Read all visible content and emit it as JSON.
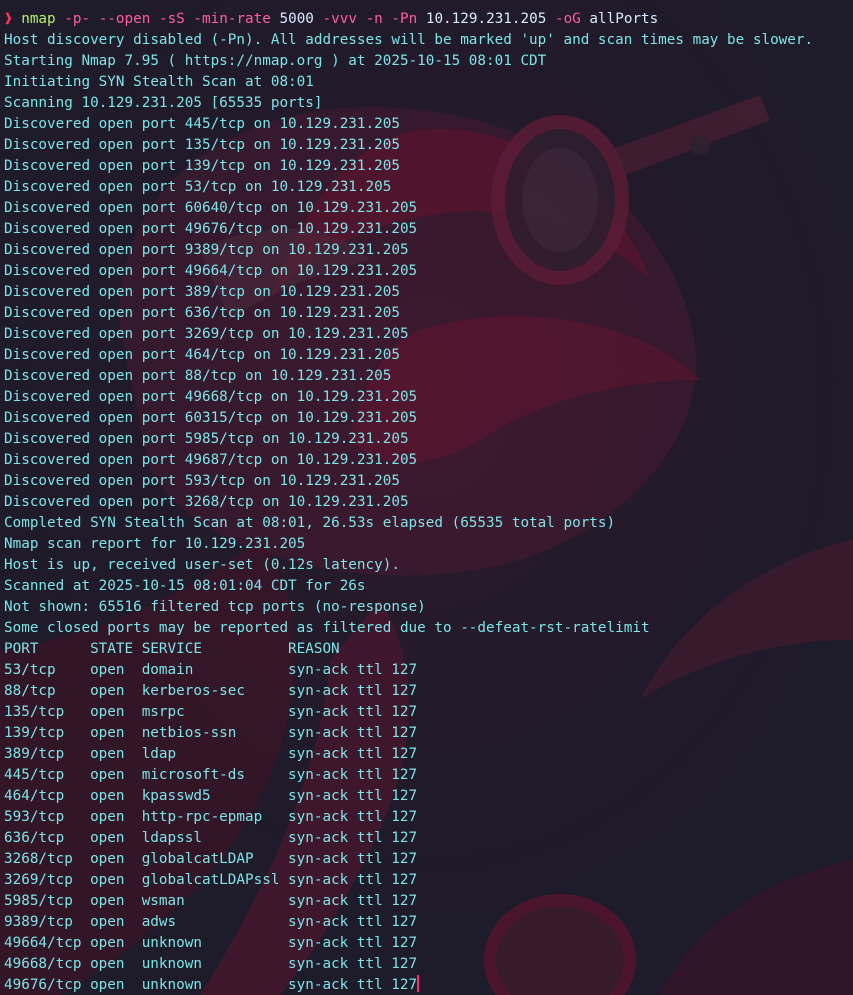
{
  "prompt": {
    "symbol": "❱",
    "command": "nmap",
    "tokens": [
      {
        "text": "-p-",
        "kind": "flag"
      },
      {
        "text": "--open",
        "kind": "flag"
      },
      {
        "text": "-sS",
        "kind": "flag"
      },
      {
        "text": "-min-rate",
        "kind": "flag"
      },
      {
        "text": "5000",
        "kind": "arg"
      },
      {
        "text": "-vvv",
        "kind": "flag"
      },
      {
        "text": "-n",
        "kind": "flag"
      },
      {
        "text": "-Pn",
        "kind": "flag"
      },
      {
        "text": "10.129.231.205",
        "kind": "arg"
      },
      {
        "text": "-oG",
        "kind": "flag"
      },
      {
        "text": "allPorts",
        "kind": "arg"
      }
    ]
  },
  "output_lines": [
    "Host discovery disabled (-Pn). All addresses will be marked 'up' and scan times may be slower.",
    "Starting Nmap 7.95 ( https://nmap.org ) at 2025-10-15 08:01 CDT",
    "Initiating SYN Stealth Scan at 08:01",
    "Scanning 10.129.231.205 [65535 ports]",
    "Discovered open port 445/tcp on 10.129.231.205",
    "Discovered open port 135/tcp on 10.129.231.205",
    "Discovered open port 139/tcp on 10.129.231.205",
    "Discovered open port 53/tcp on 10.129.231.205",
    "Discovered open port 60640/tcp on 10.129.231.205",
    "Discovered open port 49676/tcp on 10.129.231.205",
    "Discovered open port 9389/tcp on 10.129.231.205",
    "Discovered open port 49664/tcp on 10.129.231.205",
    "Discovered open port 389/tcp on 10.129.231.205",
    "Discovered open port 636/tcp on 10.129.231.205",
    "Discovered open port 3269/tcp on 10.129.231.205",
    "Discovered open port 464/tcp on 10.129.231.205",
    "Discovered open port 88/tcp on 10.129.231.205",
    "Discovered open port 49668/tcp on 10.129.231.205",
    "Discovered open port 60315/tcp on 10.129.231.205",
    "Discovered open port 5985/tcp on 10.129.231.205",
    "Discovered open port 49687/tcp on 10.129.231.205",
    "Discovered open port 593/tcp on 10.129.231.205",
    "Discovered open port 3268/tcp on 10.129.231.205",
    "Completed SYN Stealth Scan at 08:01, 26.53s elapsed (65535 total ports)",
    "Nmap scan report for 10.129.231.205",
    "Host is up, received user-set (0.12s latency).",
    "Scanned at 2025-10-15 08:01:04 CDT for 26s",
    "Not shown: 65516 filtered tcp ports (no-response)",
    "Some closed ports may be reported as filtered due to --defeat-rst-ratelimit"
  ],
  "port_table": {
    "headers": [
      "PORT",
      "STATE",
      "SERVICE",
      "REASON"
    ],
    "rows": [
      [
        "53/tcp",
        "open",
        "domain",
        "syn-ack ttl 127"
      ],
      [
        "88/tcp",
        "open",
        "kerberos-sec",
        "syn-ack ttl 127"
      ],
      [
        "135/tcp",
        "open",
        "msrpc",
        "syn-ack ttl 127"
      ],
      [
        "139/tcp",
        "open",
        "netbios-ssn",
        "syn-ack ttl 127"
      ],
      [
        "389/tcp",
        "open",
        "ldap",
        "syn-ack ttl 127"
      ],
      [
        "445/tcp",
        "open",
        "microsoft-ds",
        "syn-ack ttl 127"
      ],
      [
        "464/tcp",
        "open",
        "kpasswd5",
        "syn-ack ttl 127"
      ],
      [
        "593/tcp",
        "open",
        "http-rpc-epmap",
        "syn-ack ttl 127"
      ],
      [
        "636/tcp",
        "open",
        "ldapssl",
        "syn-ack ttl 127"
      ],
      [
        "3268/tcp",
        "open",
        "globalcatLDAP",
        "syn-ack ttl 127"
      ],
      [
        "3269/tcp",
        "open",
        "globalcatLDAPssl",
        "syn-ack ttl 127"
      ],
      [
        "5985/tcp",
        "open",
        "wsman",
        "syn-ack ttl 127"
      ],
      [
        "9389/tcp",
        "open",
        "adws",
        "syn-ack ttl 127"
      ],
      [
        "49664/tcp",
        "open",
        "unknown",
        "syn-ack ttl 127"
      ],
      [
        "49668/tcp",
        "open",
        "unknown",
        "syn-ack ttl 127"
      ],
      [
        "49676/tcp",
        "open",
        "unknown",
        "syn-ack ttl 127"
      ]
    ]
  },
  "colors": {
    "background": "#1e1b2a",
    "output_text": "#7ee3e6",
    "prompt_symbol": "#ff2f61",
    "command": "#b6f06a",
    "flag": "#ff5da2",
    "argument": "#d9e9ff",
    "cursor": "#ff2f61",
    "wallpaper_accent": "#6b1230"
  },
  "icons": {
    "prompt": "chevron-right-icon",
    "wallpaper": "masked-figure-wallpaper"
  }
}
